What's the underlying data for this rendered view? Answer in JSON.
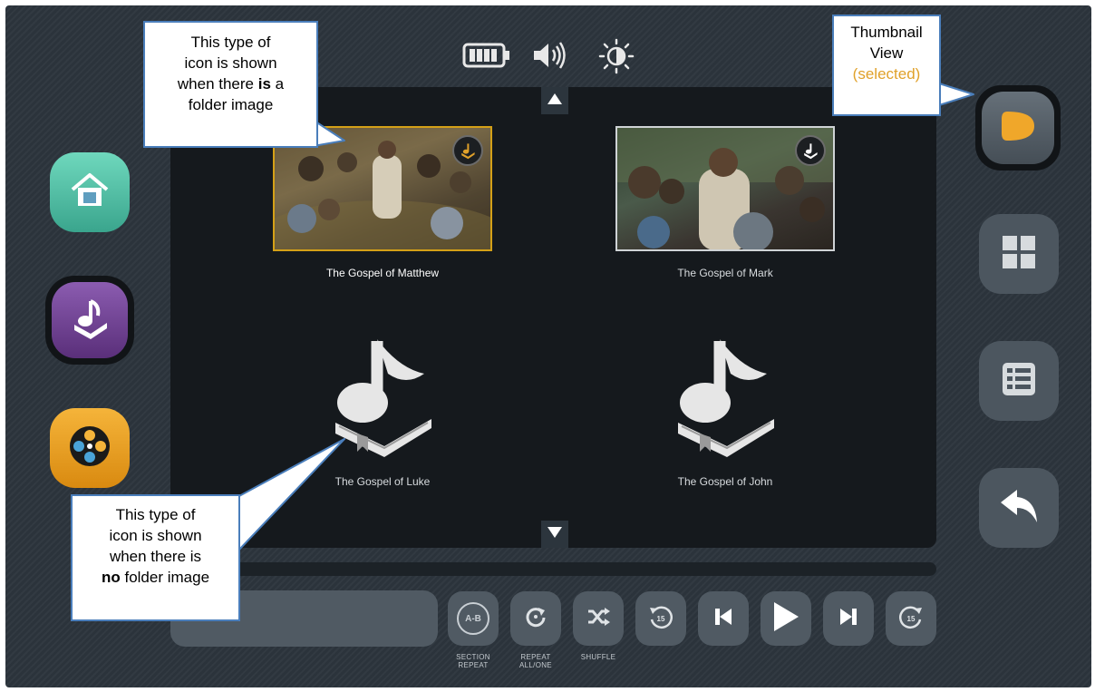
{
  "status_bar": {
    "battery_icon": "battery-full-icon",
    "volume_icon": "volume-icon",
    "brightness_icon": "brightness-icon"
  },
  "left_nav": [
    {
      "name": "home",
      "icon": "home-icon",
      "color": "#4fc3a9"
    },
    {
      "name": "audio-scripture",
      "icon": "music-book-icon",
      "color": "#6b3b8c",
      "selected": true
    },
    {
      "name": "video",
      "icon": "film-reel-icon",
      "color": "#f0a020"
    }
  ],
  "right_nav": [
    {
      "name": "thumbnail-view",
      "icon": "thumbnail-view-icon",
      "selected": true
    },
    {
      "name": "grid-view",
      "icon": "grid-view-icon"
    },
    {
      "name": "list-view",
      "icon": "list-view-icon"
    },
    {
      "name": "back",
      "icon": "back-arrow-icon"
    }
  ],
  "folders": [
    {
      "title": "The Gospel of Matthew",
      "has_image": true,
      "selected": true
    },
    {
      "title": "The Gospel of Mark",
      "has_image": true
    },
    {
      "title": "The Gospel of Luke",
      "has_image": false
    },
    {
      "title": "The Gospel of John",
      "has_image": false
    }
  ],
  "controls": {
    "section_repeat": {
      "glyph": "A-B",
      "label_1": "SECTION",
      "label_2": "REPEAT"
    },
    "repeat": {
      "label_1": "REPEAT",
      "label_2": "ALL/ONE"
    },
    "shuffle": {
      "label_1": "SHUFFLE"
    },
    "rewind_label": "15",
    "forward_label": "15"
  },
  "callouts": {
    "top_left": {
      "line1": "This type of",
      "line2": "icon is shown",
      "line3_pre": "when there ",
      "line3_bold": "is",
      "line3_post": " a",
      "line4": "folder image"
    },
    "top_right": {
      "line1": "Thumbnail",
      "line2": "View",
      "line3": "(selected)"
    },
    "bottom_left": {
      "line1": "This type of",
      "line2": "icon is shown",
      "line3": "when there is",
      "line4_bold": "no",
      "line4_post": " folder image"
    }
  },
  "colors": {
    "accent": "#e0a12a",
    "callout_border": "#4a7ebb",
    "screen_bg": "#15191d",
    "device_bg": "#2b333b"
  }
}
